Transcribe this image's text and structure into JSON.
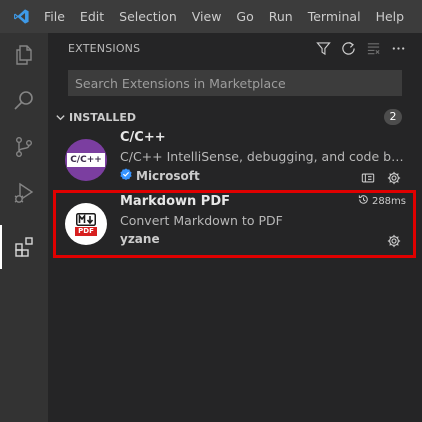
{
  "menubar": {
    "items": [
      "File",
      "Edit",
      "Selection",
      "View",
      "Go",
      "Run",
      "Terminal",
      "Help"
    ]
  },
  "activity": {
    "icons": [
      "files-icon",
      "search-icon",
      "source-control-icon",
      "run-debug-icon",
      "extensions-icon"
    ]
  },
  "sidebar": {
    "title": "EXTENSIONS",
    "search_placeholder": "Search Extensions in Marketplace",
    "section": {
      "title": "INSTALLED",
      "count": "2"
    },
    "extensions": [
      {
        "icon_label": "C/C++",
        "name": "C/C++",
        "description": "C/C++ IntelliSense, debugging, and code browsing.",
        "publisher": "Microsoft",
        "verified": true
      },
      {
        "icon_label": "PDF",
        "name": "Markdown PDF",
        "description": "Convert Markdown to PDF",
        "publisher": "yzane",
        "activation_time": "288ms"
      }
    ]
  },
  "colors": {
    "highlight_border": "#e00000",
    "verified_badge": "#3794ff",
    "cpp_icon_bg": "#7b3ea0"
  }
}
